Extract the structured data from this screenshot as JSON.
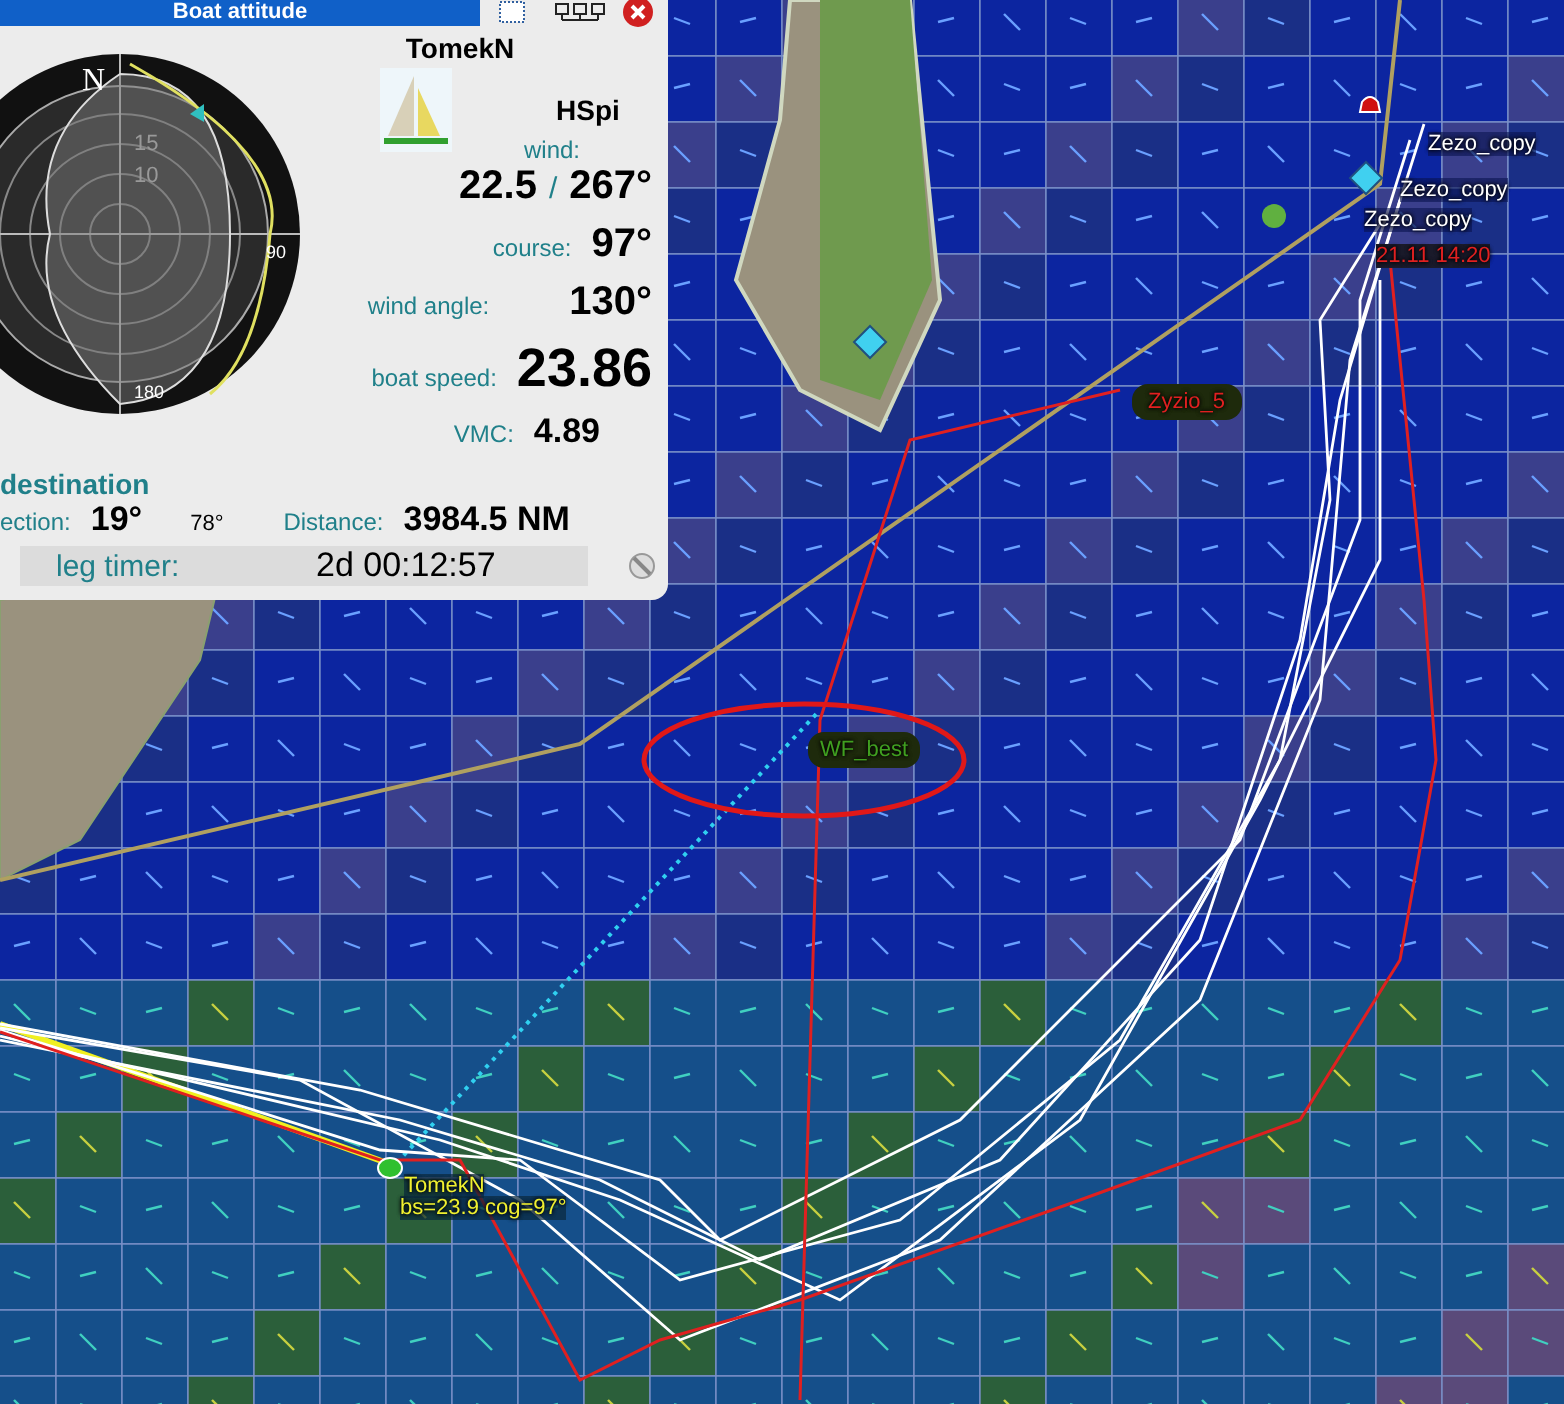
{
  "panel": {
    "title": "Boat attitude",
    "boat_name": "TomekN",
    "sail": "HSpi",
    "dial_labels": [
      "N",
      "15",
      "10",
      "90",
      "180"
    ],
    "wind": {
      "label": "wind:",
      "speed": "22.5",
      "separator": "/",
      "direction": "267°"
    },
    "readings": [
      {
        "label": "course:",
        "value": "97°",
        "kind": "large"
      },
      {
        "label": "wind angle:",
        "value": "130°",
        "kind": "large"
      },
      {
        "label": "boat speed:",
        "value": "23.86",
        "kind": "huge"
      },
      {
        "label": "VMC:",
        "value": "4.89",
        "kind": "medium"
      }
    ],
    "destination": {
      "title": "destination",
      "direction_label": "ection:",
      "direction": "19°",
      "bearing": "78°",
      "distance_label": "Distance:",
      "distance": "3984.5 NM"
    },
    "leg_timer": {
      "label": "leg timer:",
      "value": "2d 00:12:57"
    }
  },
  "map": {
    "labels": [
      {
        "text": "Zezo_copy",
        "kind": "route"
      },
      {
        "text": "Zezo_copy",
        "kind": "route"
      },
      {
        "text": "Zezo_copy",
        "kind": "route"
      },
      {
        "text": "21.11 14:20",
        "kind": "time"
      },
      {
        "text": "Zyzio_5",
        "kind": "rival"
      },
      {
        "text": "WF_best",
        "kind": "friend"
      },
      {
        "text": "TomekN",
        "kind": "own"
      },
      {
        "text": "bs=23.9 cog=97°",
        "kind": "own"
      }
    ]
  }
}
